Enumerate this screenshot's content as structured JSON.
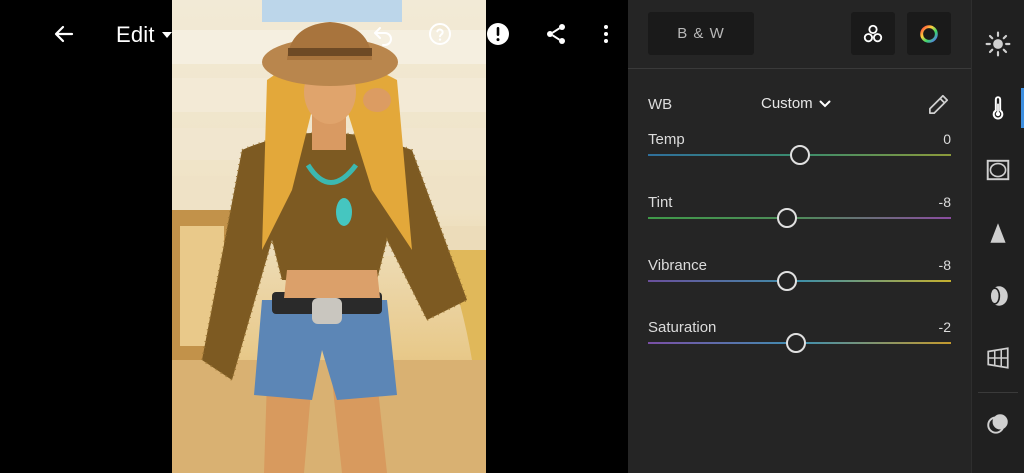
{
  "header": {
    "edit_label": "Edit"
  },
  "panel": {
    "bw_label": "B & W",
    "wb": {
      "label": "WB",
      "value": "Custom"
    },
    "sliders": [
      {
        "label": "Temp",
        "value": "0",
        "position": 0.5,
        "gradient": [
          "#2f6f9c",
          "#3a8c6d",
          "#8c9a3a"
        ]
      },
      {
        "label": "Tint",
        "value": "-8",
        "position": 0.46,
        "gradient": [
          "#3f9a49",
          "#4f8a5a",
          "#8a4ca0"
        ]
      },
      {
        "label": "Vibrance",
        "value": "-8",
        "position": 0.46,
        "gradient": [
          "#6a4f9c",
          "#3e8fa8",
          "#c5b02e"
        ]
      },
      {
        "label": "Saturation",
        "value": "-2",
        "position": 0.49,
        "gradient": [
          "#7a4fa6",
          "#3f8fb0",
          "#c49a2e"
        ]
      }
    ]
  },
  "icons": {
    "back": "arrow-left-icon",
    "undo": "undo-icon",
    "help": "help-icon",
    "alert": "alert-icon",
    "share": "share-icon",
    "more": "more-vertical-icon"
  },
  "colors": {
    "panel_bg": "#252525",
    "accent": "#3d8fe0"
  }
}
